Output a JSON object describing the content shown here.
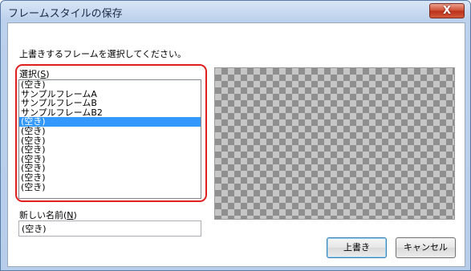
{
  "window": {
    "title": "フレームスタイルの保存",
    "close_glyph": "X"
  },
  "instruction": "上書きするフレームを選択してください。",
  "list": {
    "label_prefix": "選択(",
    "label_key": "S",
    "label_suffix": ")",
    "items": [
      "(空き)",
      "サンプルフレームA",
      "サンプルフレームB",
      "サンプルフレームB2",
      "(空き)",
      "(空き)",
      "(空き)",
      "(空き)",
      "(空き)",
      "(空き)",
      "(空き)",
      "(空き)"
    ],
    "selected_index": 4,
    "highlight_color": "#3399ff"
  },
  "name_field": {
    "label_prefix": "新しい名前(",
    "label_key": "N",
    "label_suffix": ")",
    "value": "(空き)"
  },
  "buttons": {
    "overwrite": "上書き",
    "cancel": "キャンセル"
  },
  "colors": {
    "highlight_box": "#e02020"
  }
}
